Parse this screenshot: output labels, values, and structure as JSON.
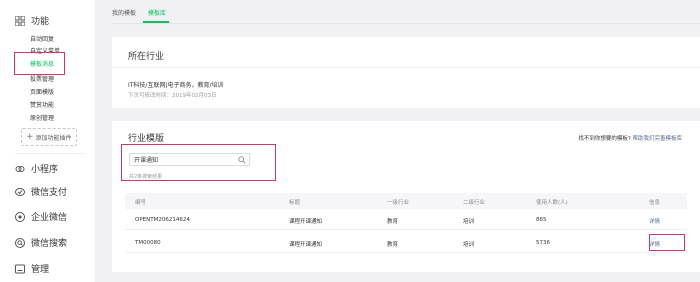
{
  "sidebar": {
    "sections": [
      {
        "label": "功能",
        "icon": "grid-icon"
      },
      {
        "label": "小程序",
        "icon": "mini-program-icon"
      },
      {
        "label": "微信支付",
        "icon": "wechat-pay-icon"
      },
      {
        "label": "企业微信",
        "icon": "work-wechat-icon"
      },
      {
        "label": "微信搜索",
        "icon": "wechat-search-icon"
      },
      {
        "label": "管理",
        "icon": "manage-icon"
      }
    ],
    "items": [
      "自动回复",
      "自定义菜单",
      "模板消息",
      "投票管理",
      "页面模版",
      "赞赏功能",
      "原创管理"
    ],
    "add_plugin": "添加功能插件"
  },
  "tabs": [
    "我的模板",
    "模板库"
  ],
  "industry": {
    "title": "所在行业",
    "value": "IT科技/互联网|电子商务，教育/培训",
    "next_change": "下次可修改时间：2019年02月03日"
  },
  "templates": {
    "title": "行业模版",
    "help_prefix": "找不到你想要的模板?",
    "help_link": "帮助我们完善模板库",
    "search_value": "开课通知",
    "result_count": "共2条搜索结果",
    "columns": [
      "编号",
      "标题",
      "一级行业",
      "二级行业",
      "使用人数(人)",
      "信息"
    ],
    "rows": [
      {
        "id": "OPENTM206214624",
        "title": "课程开课通知",
        "industry1": "教育",
        "industry2": "培训",
        "users": "865",
        "action": "详情"
      },
      {
        "id": "TM00080",
        "title": "课程开课通知",
        "industry1": "教育",
        "industry2": "培训",
        "users": "5736",
        "action": "详情"
      }
    ]
  },
  "colors": {
    "accent": "#07c160",
    "link": "#576b95",
    "highlight": "#d6336c"
  }
}
